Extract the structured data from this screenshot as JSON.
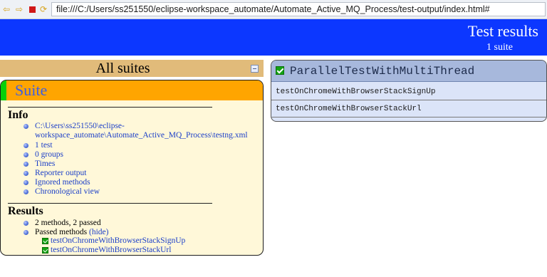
{
  "browser": {
    "url": "file:///C:/Users/ss251550/eclipse-workspace_automate/Automate_Active_MQ_Process/test-output/index.html#",
    "back_icon": "arrow-left-icon",
    "forward_icon": "arrow-right-icon",
    "stop_icon": "stop-icon",
    "refresh_icon": "refresh-icon"
  },
  "header": {
    "title": "Test results",
    "subtitle": "1 suite",
    "background": "#0c37ff"
  },
  "sidebar": {
    "title": "All suites",
    "collapse_icon": "collapse-icon",
    "suite": {
      "name": "Suite",
      "info_title": "Info",
      "info_items": [
        "C:\\Users\\ss251550\\eclipse-",
        "workspace_automate\\Automate_Active_MQ_Process\\testng.xml",
        "1 test",
        "0 groups",
        "Times",
        "Reporter output",
        "Ignored methods",
        "Chronological view"
      ],
      "results_title": "Results",
      "results_summary": "2 methods, 2 passed",
      "passed_label": "Passed methods",
      "hide_label": "(hide)",
      "passed_methods": [
        "testOnChromeWithBrowserStackSignUp",
        "testOnChromeWithBrowserStackUrl"
      ]
    }
  },
  "test_panel": {
    "title": "ParallelTestWithMultiThread",
    "methods": [
      "testOnChromeWithBrowserStackSignUp",
      "testOnChromeWithBrowserStackUrl"
    ]
  }
}
